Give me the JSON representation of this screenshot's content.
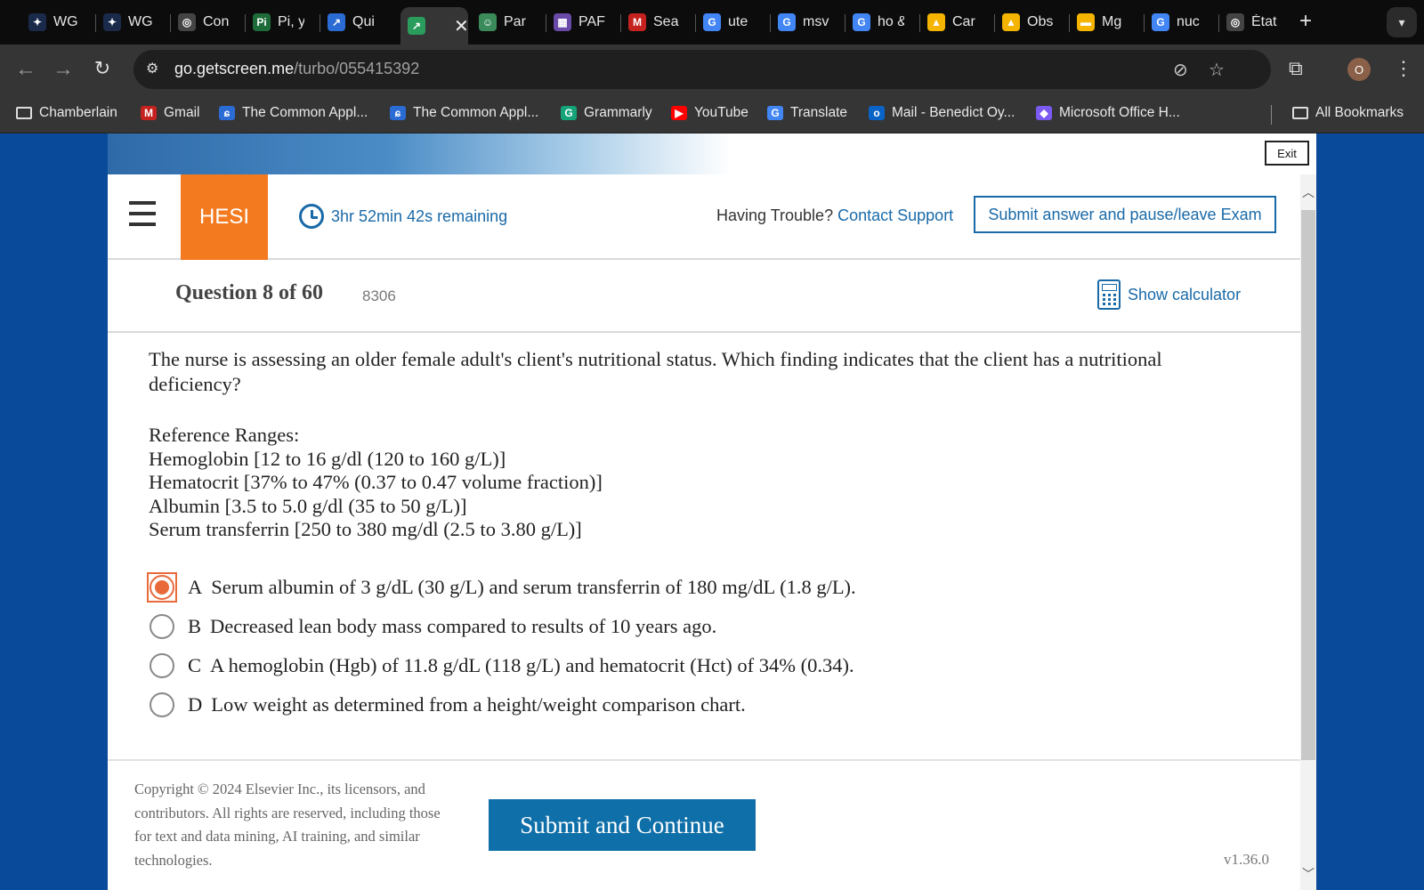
{
  "browser": {
    "tabs": [
      {
        "label": "WG",
        "icon": "wolf-icon",
        "color": "#1a2a4a"
      },
      {
        "label": "WG",
        "icon": "wolf-icon",
        "color": "#1a2a4a"
      },
      {
        "label": "Con",
        "icon": "chatgpt-icon",
        "color": "#444444"
      },
      {
        "label": "Pi, y",
        "icon": "pi-icon",
        "color": "#1e6b3a"
      },
      {
        "label": "Qui",
        "icon": "arrow-icon",
        "color": "#2b6cd4"
      },
      {
        "label": "",
        "icon": "arrow-icon",
        "color": "#2a9d5c",
        "active": true
      },
      {
        "label": "Par",
        "icon": "robot-icon",
        "color": "#3a8a5a"
      },
      {
        "label": "PAF",
        "icon": "grid-icon",
        "color": "#6a4aa8"
      },
      {
        "label": "Sea",
        "icon": "gmail-icon",
        "color": "#c5221f"
      },
      {
        "label": "ute",
        "icon": "google-icon",
        "color": "#4285f4"
      },
      {
        "label": "msv",
        "icon": "google-icon",
        "color": "#4285f4"
      },
      {
        "label": "ho &",
        "icon": "google-icon",
        "color": "#4285f4"
      },
      {
        "label": "Car",
        "icon": "drive-icon",
        "color": "#f4b400"
      },
      {
        "label": "Obs",
        "icon": "drive-icon",
        "color": "#f4b400"
      },
      {
        "label": "Mg",
        "icon": "slides-icon",
        "color": "#f4b400"
      },
      {
        "label": "nuc",
        "icon": "google-icon",
        "color": "#4285f4"
      },
      {
        "label": "État",
        "icon": "chatgpt-icon",
        "color": "#444444"
      }
    ],
    "close_glyph": "✕",
    "new_tab_glyph": "+",
    "url_host": "go.getscreen.me",
    "url_path": "/turbo/055415392",
    "profile_initial": "O",
    "bookmarks": [
      {
        "label": "Chamberlain",
        "icon": "folder-icon"
      },
      {
        "label": "Gmail",
        "icon": "gmail-icon",
        "color": "#c5221f"
      },
      {
        "label": "The Common Appl...",
        "icon": "commonapp-icon",
        "color": "#2b6cd4"
      },
      {
        "label": "The Common Appl...",
        "icon": "commonapp-icon",
        "color": "#2b6cd4"
      },
      {
        "label": "Grammarly",
        "icon": "grammarly-icon",
        "color": "#15a37a"
      },
      {
        "label": "YouTube",
        "icon": "youtube-icon",
        "color": "#ff0000"
      },
      {
        "label": "Translate",
        "icon": "translate-icon",
        "color": "#4285f4"
      },
      {
        "label": "Mail - Benedict Oy...",
        "icon": "outlook-icon",
        "color": "#0a64c8"
      },
      {
        "label": "Microsoft Office H...",
        "icon": "copilot-icon",
        "color": "#7a5af0"
      }
    ],
    "all_bookmarks": "All Bookmarks"
  },
  "exam": {
    "exit_label": "Exit",
    "brand": "HESI",
    "timer": "3hr 52min 42s remaining",
    "trouble_prefix": "Having Trouble?",
    "contact_support": "Contact Support",
    "submit_pause": "Submit answer and pause/leave Exam",
    "question_number": "Question 8 of 60",
    "question_id": "8306",
    "show_calculator": "Show calculator",
    "stem": "The nurse is assessing an older female adult's client's nutritional status. Which finding indicates that the client has a nutritional deficiency?",
    "reference_title": "Reference Ranges:",
    "reference_ranges": [
      "Hemoglobin [12 to 16 g/dl (120 to 160 g/L)]",
      "Hematocrit [37% to 47% (0.37 to 0.47 volume fraction)]",
      "Albumin [3.5 to 5.0 g/dl (35 to 50 g/L)]",
      "Serum transferrin [250 to 380 mg/dl (2.5 to 3.80 g/L)]"
    ],
    "options": [
      {
        "letter": "A",
        "text": "Serum albumin of 3 g/dL (30 g/L) and serum transferrin of 180 mg/dL (1.8 g/L).",
        "selected": true
      },
      {
        "letter": "B",
        "text": "Decreased lean body mass compared to results of 10 years ago.",
        "selected": false
      },
      {
        "letter": "C",
        "text": "A hemoglobin (Hgb) of 11.8 g/dL (118 g/L)  and hematocrit (Hct) of 34% (0.34).",
        "selected": false
      },
      {
        "letter": "D",
        "text": "Low weight as determined from a height/weight comparison chart.",
        "selected": false
      }
    ],
    "copyright": "Copyright © 2024 Elsevier Inc., its licensors, and contributors. All rights are reserved, including those for text and data mining, AI training, and similar technologies.",
    "submit_continue": "Submit and Continue",
    "version": "v1.36.0",
    "colors": {
      "accent": "#1a6aa8",
      "brand_orange": "#f47a20",
      "selected": "#e86a3a",
      "button": "#0f6fa8"
    }
  }
}
